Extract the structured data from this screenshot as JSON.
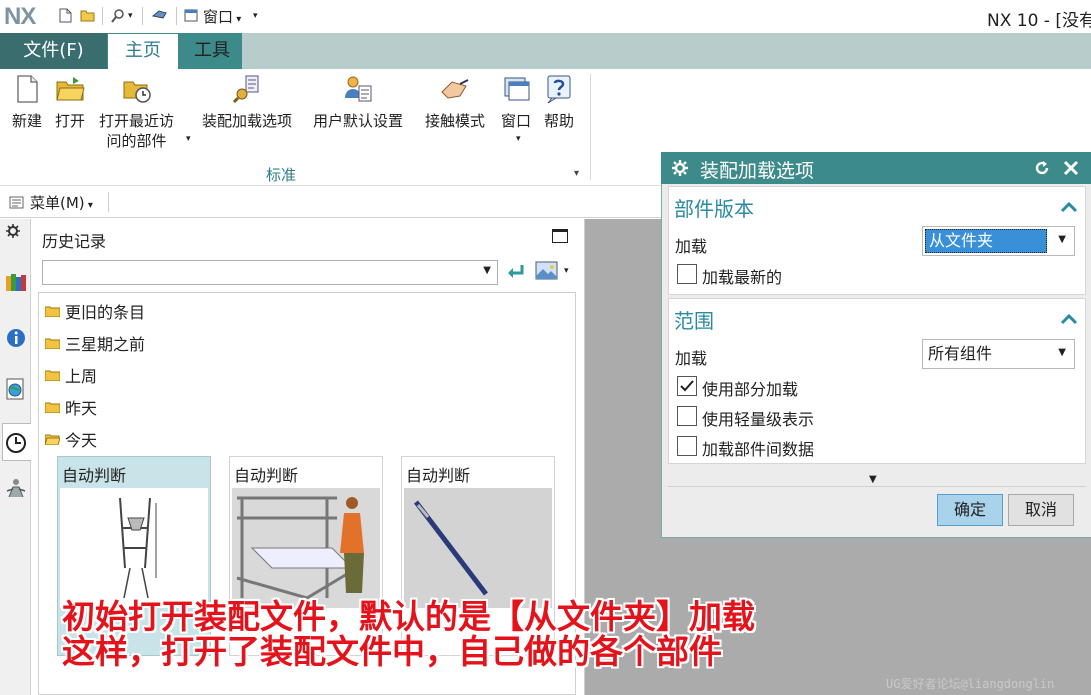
{
  "app": {
    "logo": "NX",
    "window_menu": "窗口",
    "window_title": "NX 10 - [没有"
  },
  "tabs": {
    "file": "文件(F)",
    "home": "主页",
    "tools": "工具"
  },
  "ribbon": {
    "buttons": [
      "新建",
      "打开",
      "打开最近访",
      "问的部件",
      "装配加载选项",
      "用户默认设置",
      "接触模式",
      "窗口",
      "帮助"
    ],
    "group_label": "标准"
  },
  "menu": {
    "label": "菜单(M)"
  },
  "history": {
    "title": "历史记录",
    "folders": [
      "更旧的条目",
      "三星期之前",
      "上周",
      "昨天",
      "今天"
    ],
    "cards": [
      "自动判断",
      "自动判断",
      "自动判断"
    ]
  },
  "dialog": {
    "title": "装配加载选项",
    "section1": {
      "title": "部件版本",
      "load_label": "加载",
      "load_value": "从文件夹",
      "checkbox": "加载最新的"
    },
    "section2": {
      "title": "范围",
      "load_label": "加载",
      "load_value": "所有组件",
      "checkboxes": [
        {
          "label": "使用部分加载",
          "checked": true
        },
        {
          "label": "使用轻量级表示",
          "checked": false
        },
        {
          "label": "加载部件间数据",
          "checked": false
        }
      ]
    },
    "ok": "确定",
    "cancel": "取消"
  },
  "overlay": {
    "line1": "初始打开装配文件，默认的是【从文件夹】加载",
    "line2": "这样，打开了装配文件中，自己做的各个部件"
  },
  "watermark": "UG爱好者论坛@liangdonglin",
  "colors": {
    "accent_teal": "#3d8a8a",
    "file_tab": "#3a6e6e",
    "section_title": "#2a8aa2",
    "overlay_red": "#e4121a",
    "ok_button": "#a9d3ea"
  }
}
